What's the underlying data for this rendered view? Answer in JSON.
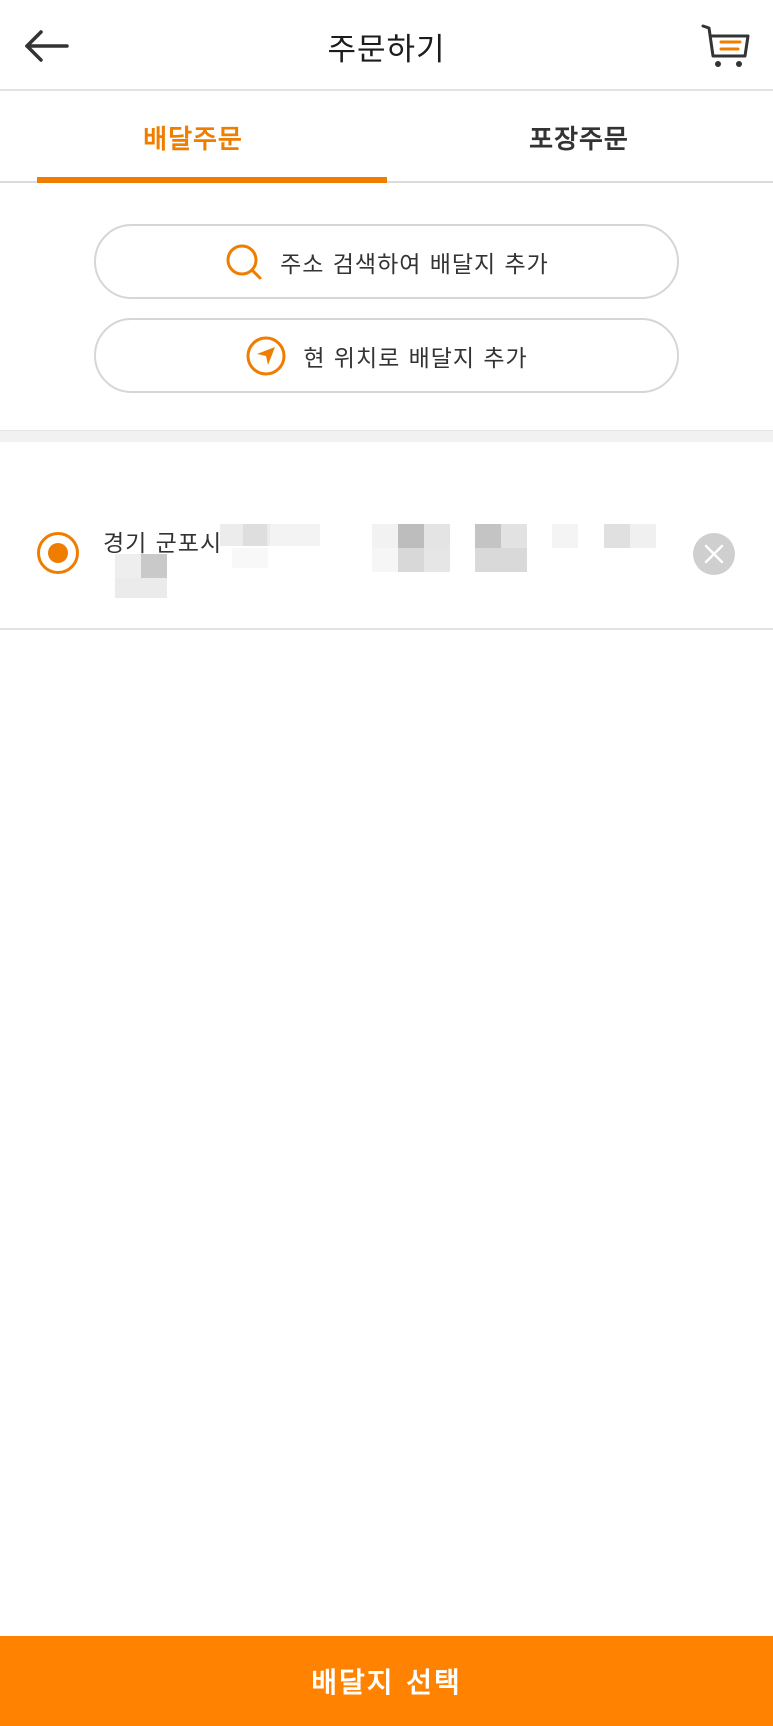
{
  "header": {
    "title": "주문하기",
    "back_icon": "arrow-left-icon",
    "cart_icon": "cart-icon"
  },
  "tabs": [
    {
      "label": "배달주문",
      "active": true
    },
    {
      "label": "포장주문",
      "active": false
    }
  ],
  "actions": {
    "search_label": "주소 검색하여 배달지 추가",
    "search_icon": "search-icon",
    "location_label": "현 위치로 배달지 추가",
    "location_icon": "location-arrow-icon"
  },
  "addresses": [
    {
      "text": "경기 군포시",
      "selected": true,
      "redacted": true
    }
  ],
  "footer": {
    "confirm_label": "배달지 선택"
  },
  "colors": {
    "accent": "#ef7d00",
    "button_bg": "#ff8200",
    "divider": "#e3e3e3",
    "delete_bg": "#cfcfcf"
  }
}
